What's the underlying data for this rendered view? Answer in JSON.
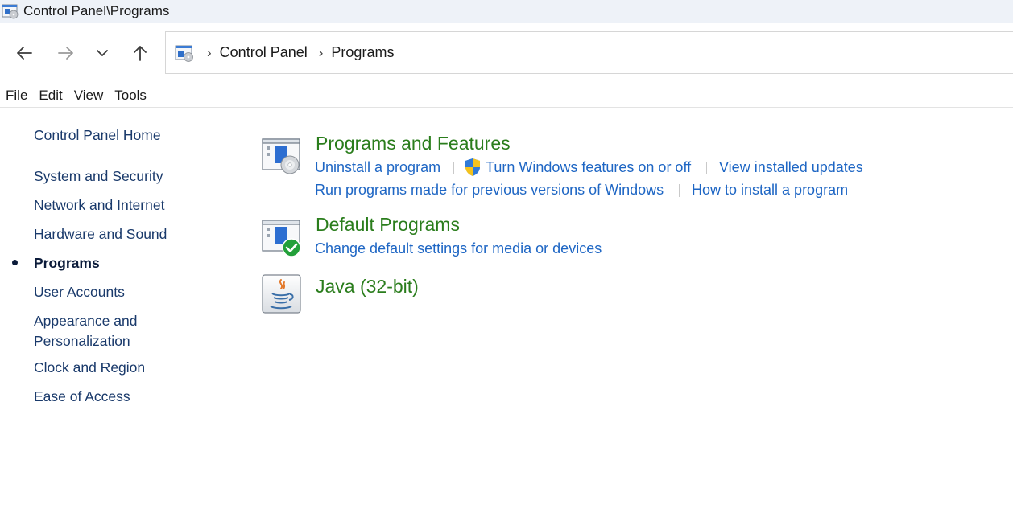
{
  "window": {
    "title": "Control Panel\\Programs"
  },
  "nav": {
    "back_icon": "back-arrow-icon",
    "forward_icon": "forward-arrow-icon",
    "recent_icon": "chevron-down-icon",
    "up_icon": "up-arrow-icon"
  },
  "address": {
    "crumbs": [
      "Control Panel",
      "Programs"
    ]
  },
  "menu": {
    "items": [
      "File",
      "Edit",
      "View",
      "Tools"
    ]
  },
  "sidebar": {
    "home": "Control Panel Home",
    "items": [
      "System and Security",
      "Network and Internet",
      "Hardware and Sound",
      "Programs",
      "User Accounts",
      "Appearance and Personalization",
      "Clock and Region",
      "Ease of Access"
    ],
    "appearance_line1": "Appearance and",
    "appearance_line2": "Personalization",
    "current": "Programs"
  },
  "categories": {
    "programs_features": {
      "title": "Programs and Features",
      "tasks": [
        "Uninstall a program",
        "Turn Windows features on or off",
        "View installed updates",
        "Run programs made for previous versions of Windows",
        "How to install a program"
      ]
    },
    "default_programs": {
      "title": "Default Programs",
      "tasks": [
        "Change default settings for media or devices"
      ]
    },
    "java": {
      "title": "Java (32-bit)"
    }
  },
  "colors": {
    "category_title": "#2a7d1c",
    "task_link": "#1e66c4",
    "sidebar_link": "#1a3a6b",
    "titlebar_bg": "#eef2f8"
  }
}
